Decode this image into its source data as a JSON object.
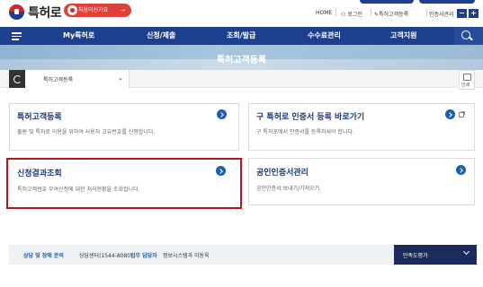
{
  "header": {
    "logo_text": "특허로",
    "banner_text": "처음이신가요",
    "banner_arrow": "→",
    "utility_links": [
      "HOME",
      "로그인",
      "특허고객등록",
      "인증서관리"
    ],
    "font_minus": "−",
    "font_plus": "+"
  },
  "nav": {
    "items": [
      "My특허로",
      "신청/제출",
      "조회/발급",
      "수수료관리",
      "고객지원"
    ]
  },
  "page": {
    "title": "특허고객등록"
  },
  "subnav": {
    "breadcrumb": "특허고객등록",
    "print_label": "인쇄"
  },
  "cards": [
    {
      "title": "특허고객등록",
      "desc": "출원 및 특허로 이용을 위하여 사용자 고유번호를 신청합니다."
    },
    {
      "title": "구 특허로 인증서 등록 바로가기",
      "desc": "구 특허로에서 인증서를 등록하셔야 합니다."
    },
    {
      "title": "신청결과조회",
      "desc": "특허고객번호 부여신청에 대한 처리현황을 조회합니다."
    },
    {
      "title": "공인인증서관리",
      "desc": "공인인증서 보내기/가져오기."
    }
  ],
  "footer": {
    "support_label": "상담 및 장애 문의",
    "support_value": "상담센터(1544-8080)",
    "manager_label": "업무 담당자",
    "manager_value": "정보시스템과 이동욱",
    "survey_label": "만족도평가"
  },
  "colors": {
    "nav_bg": "#1c3f8f",
    "highlight_border": "#b3181b",
    "footer_dark": "#1a2b5c"
  }
}
